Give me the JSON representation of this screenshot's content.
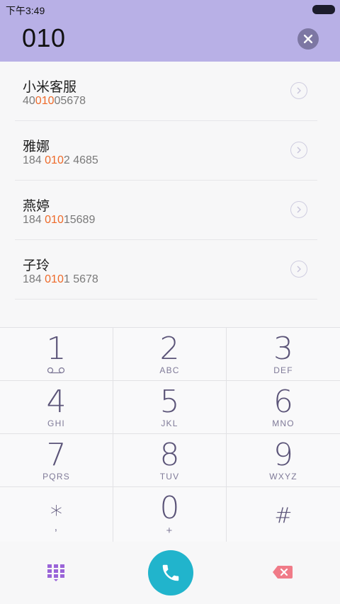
{
  "status_bar": {
    "time": "下午3:49"
  },
  "dialer": {
    "number": "010"
  },
  "results": [
    {
      "name": "小米客服",
      "number_parts": [
        "40",
        "010",
        "05678"
      ]
    },
    {
      "name": "雅娜",
      "number_parts": [
        "184 ",
        "010",
        "2 4685"
      ]
    },
    {
      "name": "燕婷",
      "number_parts": [
        "184 ",
        "010",
        "15689"
      ]
    },
    {
      "name": "子玲",
      "number_parts": [
        "184 ",
        "010",
        "1 5678"
      ]
    }
  ],
  "keypad": [
    {
      "digit": "1",
      "letters": ""
    },
    {
      "digit": "2",
      "letters": "ABC"
    },
    {
      "digit": "3",
      "letters": "DEF"
    },
    {
      "digit": "4",
      "letters": "GHI"
    },
    {
      "digit": "5",
      "letters": "JKL"
    },
    {
      "digit": "6",
      "letters": "MNO"
    },
    {
      "digit": "7",
      "letters": "PQRS"
    },
    {
      "digit": "8",
      "letters": "TUV"
    },
    {
      "digit": "9",
      "letters": "WXYZ"
    },
    {
      "digit": "*",
      "letters": ","
    },
    {
      "digit": "0",
      "letters": "+"
    },
    {
      "digit": "#",
      "letters": ""
    }
  ],
  "icons": {
    "clear": "close-icon",
    "detail": "chevron-right-icon",
    "voicemail": "voicemail-icon",
    "keypad_toggle": "dialpad-icon",
    "call": "phone-icon",
    "backspace": "backspace-icon"
  },
  "colors": {
    "header": "#b8b0e6",
    "highlight": "#ee6a2a",
    "call_button": "#21b4cc",
    "backspace": "#f07b88",
    "dialpad_icon": "#9a64d8"
  }
}
